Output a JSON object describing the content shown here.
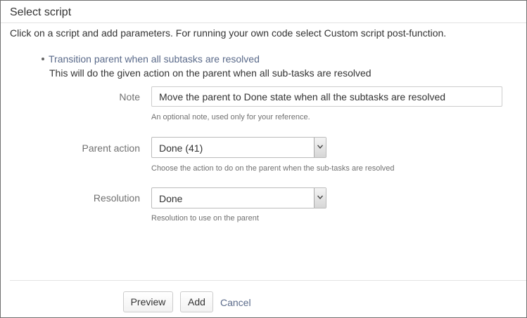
{
  "dialog": {
    "title": "Select script",
    "intro": "Click on a script and add parameters. For running your own code select Custom script post-function."
  },
  "script": {
    "name": "Transition parent when all subtasks are resolved",
    "description": "This will do the given action on the parent when all sub-tasks are resolved"
  },
  "fields": {
    "note": {
      "label": "Note",
      "value": "Move the parent to Done state when all the subtasks are resolved",
      "help": "An optional note, used only for your reference."
    },
    "parent_action": {
      "label": "Parent action",
      "value": "Done (41)",
      "help": "Choose the action to do on the parent when the sub-tasks are resolved"
    },
    "resolution": {
      "label": "Resolution",
      "value": "Done",
      "help": "Resolution to use on the parent"
    }
  },
  "buttons": {
    "preview": "Preview",
    "add": "Add",
    "cancel": "Cancel"
  },
  "icons": {
    "select_arrow": "chevron-down-icon"
  }
}
